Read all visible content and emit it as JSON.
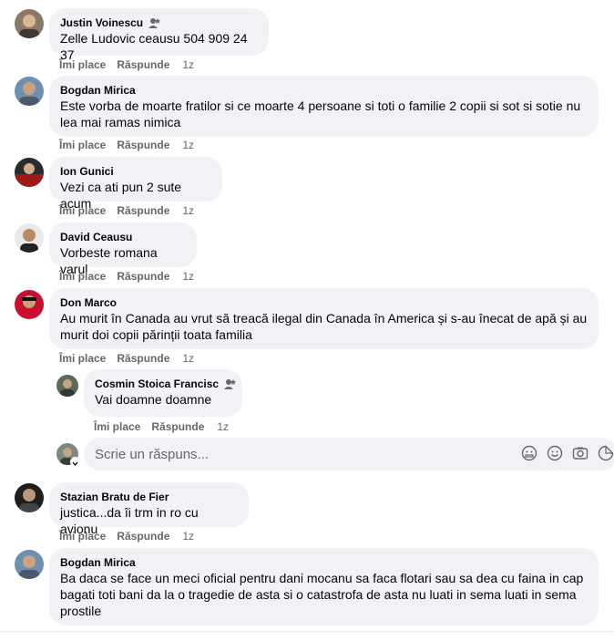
{
  "actions": {
    "like": "Îmi place",
    "reply": "Răspunde"
  },
  "comments": [
    {
      "author": "Justin Voinescu",
      "text": "Zelle Ludovic ceausu 504 909 24 37",
      "time": "1z",
      "badge": "contributor-icon"
    },
    {
      "author": "Bogdan Mirica",
      "text_lines": [
        "Este vorba de moarte fratilor si ce moarte 4 persoane si toti o familie 2 copii si sot si sotie nu",
        "lea mai ramas nimica"
      ],
      "time": "1z"
    },
    {
      "author": "Ion Gunici",
      "text": "Vezi ca ati pun 2 sute acum",
      "time": "1z"
    },
    {
      "author": "David Ceausu",
      "text": "Vorbeste romana varul",
      "time": "1z"
    },
    {
      "author": "Don Marco",
      "text_lines": [
        "Au murit în Canada au vrut să treacă ilegal din Canada în America și s-au înecat de apă și au",
        "murit doi copii părinții toata familia"
      ],
      "time": "1z"
    },
    {
      "author": "Cosmin Stoica Francisc",
      "text": "Vai doamne doamne",
      "time": "1z",
      "badge": "contributor-icon"
    },
    {
      "author": "Stazian Bratu de Fier",
      "text": "justica...da îi trm in ro cu avionu",
      "time": "1z"
    },
    {
      "author": "Bogdan Mirica",
      "text_lines": [
        "Ba daca se face un meci oficial pentru dani mocanu sa faca flotari sau sa dea cu faina in cap",
        "bagati toti bani da la o tragedie de asta si o catastrofa de asta nu luati in sema luati in sema",
        "prostile"
      ],
      "time": ""
    }
  ],
  "reply_box": {
    "placeholder": "Scrie un răspuns...",
    "icons": [
      "avatar-sticker-icon",
      "emoji-icon",
      "camera-icon",
      "sticker-icon"
    ]
  }
}
